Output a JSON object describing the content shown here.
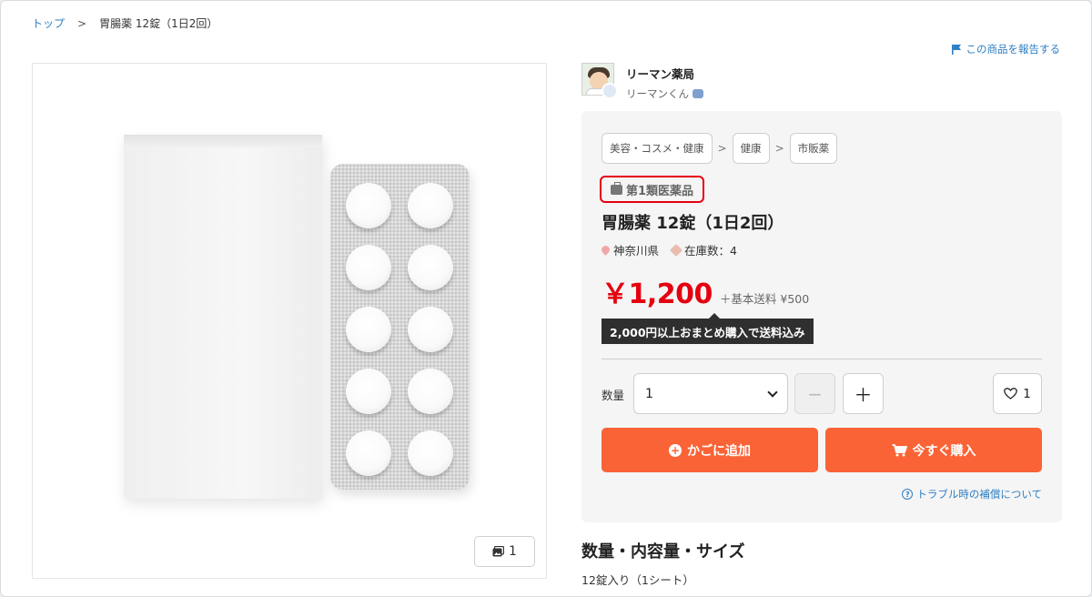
{
  "breadcrumb": {
    "home": "トップ",
    "separator": ">",
    "current": "胃腸薬 12錠（1日2回）"
  },
  "report_link": "この商品を報告する",
  "gallery": {
    "image_count": "1",
    "image_icon": "image-icon"
  },
  "seller": {
    "shop_name": "リーマン薬局",
    "user_name": "リーマンくん"
  },
  "categories": [
    "美容・コスメ・健康",
    "健康",
    "市販薬"
  ],
  "category_separator": ">",
  "drug_class": "第1類医薬品",
  "product": {
    "title": "胃腸薬 12錠（1日2回）",
    "location": "神奈川県",
    "stock": "在庫数：4",
    "price": "￥1,200",
    "shipping": "＋基本送料 ¥500",
    "free_shipping_note": "2,000円以上おまとめ購入で送料込み"
  },
  "quantity": {
    "label": "数量",
    "value": "1",
    "minus": "−",
    "plus": "＋"
  },
  "favorite_count": "1",
  "actions": {
    "add_to_cart": "かごに追加",
    "buy_now": "今すぐ購入"
  },
  "help_link": "トラブル時の補償について",
  "spec": {
    "heading": "数量・内容量・サイズ",
    "value": "12錠入り（1シート）"
  },
  "colors": {
    "accent_orange": "#fa6336",
    "price_red": "#e4000f",
    "link_blue": "#2f7fc4"
  }
}
